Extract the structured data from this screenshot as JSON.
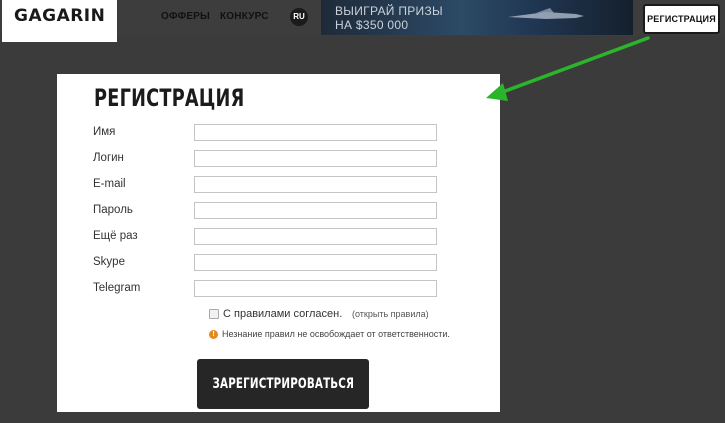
{
  "header": {
    "logo": "GAGARIN",
    "nav": [
      "ОФФЕРЫ",
      "КОНКУРС"
    ],
    "lang": "RU",
    "promo": {
      "line1": "ВЫИГРАЙ ПРИЗЫ",
      "line2": "НА $350 000"
    },
    "register_label": "РЕГИСТРАЦИЯ"
  },
  "modal": {
    "title": "РЕГИСТРАЦИЯ",
    "fields": [
      {
        "label": "Имя",
        "value": ""
      },
      {
        "label": "Логин",
        "value": ""
      },
      {
        "label": "E-mail",
        "value": ""
      },
      {
        "label": "Пароль",
        "value": ""
      },
      {
        "label": "Ещё раз",
        "value": ""
      },
      {
        "label": "Skype",
        "value": ""
      },
      {
        "label": "Telegram",
        "value": ""
      }
    ],
    "agree_text": "С правилами согласен.",
    "rules_link": "(открыть правила)",
    "warning_text": "Незнание правил не освобождает от ответственности.",
    "submit_label": "ЗАРЕГИСТРИРОВАТЬСЯ"
  },
  "colors": {
    "background": "#3b3b3b",
    "modal_bg": "#ffffff",
    "button_bg": "#262626",
    "arrow": "#2bb52b",
    "warning": "#e8891c"
  },
  "icons": [
    "checkbox-icon",
    "warning-icon",
    "arrow-annotation"
  ]
}
